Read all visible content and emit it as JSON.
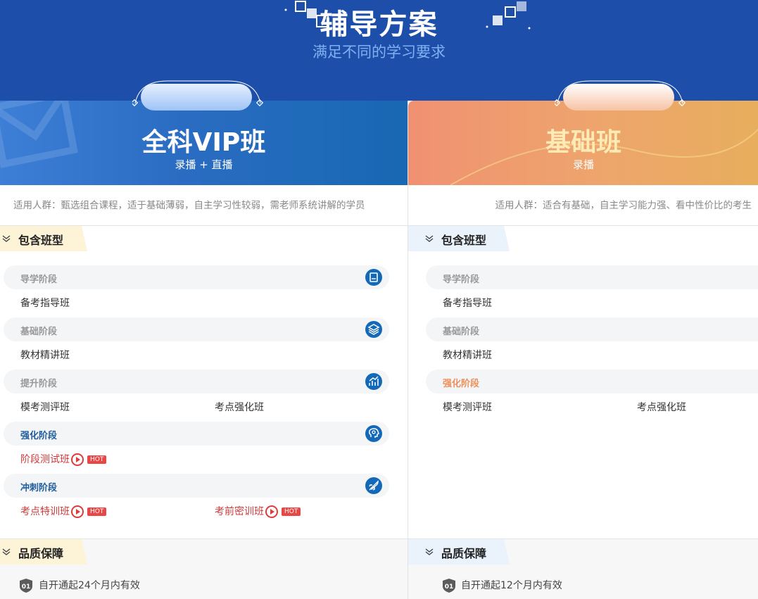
{
  "header": {
    "title": "辅导方案",
    "subtitle": "满足不同的学习要求"
  },
  "colors": {
    "header_bg": "#1d4faa",
    "vip_accent": "#1369b8",
    "basic_accent": "#ef8f5b",
    "hot_badge": "#e94646",
    "highlight_course": "#cf3b3b"
  },
  "plans": [
    {
      "title": "全科VIP班",
      "subtitle": "录播 + 直播",
      "audience": "适用人群：甄选组合课程，适于基础薄弱，自主学习性较弱，需老师系统讲解的学员",
      "included_label": "包含班型",
      "stages": [
        {
          "name": "导学阶段",
          "icon": "book-icon",
          "courses": [
            "备考指导班"
          ]
        },
        {
          "name": "基础阶段",
          "icon": "layers-icon",
          "courses": [
            "教材精讲班"
          ]
        },
        {
          "name": "提升阶段",
          "icon": "chart-icon",
          "courses": [
            "模考测评班",
            "考点强化班"
          ]
        },
        {
          "name": "强化阶段",
          "icon": "brain-icon",
          "courses": [
            "阶段测试班"
          ],
          "hot": "HOT"
        },
        {
          "name": "冲刺阶段",
          "icon": "rocket-icon",
          "courses": [
            "考点特训班",
            "考前密训班"
          ],
          "hot": "HOT"
        }
      ],
      "quality_label": "品质保障",
      "quality_badge": "01",
      "quality_text": "自开通起24个月内有效"
    },
    {
      "title": "基础班",
      "subtitle": "录播",
      "audience": "适用人群：适合有基础，自主学习能力强、看中性价比的考生",
      "included_label": "包含班型",
      "stages": [
        {
          "name": "导学阶段",
          "courses": [
            "备考指导班"
          ]
        },
        {
          "name": "基础阶段",
          "courses": [
            "教材精讲班"
          ]
        },
        {
          "name": "强化阶段",
          "courses": [
            "模考测评班",
            "考点强化班"
          ]
        }
      ],
      "quality_label": "品质保障",
      "quality_badge": "01",
      "quality_text": "自开通起12个月内有效"
    }
  ]
}
